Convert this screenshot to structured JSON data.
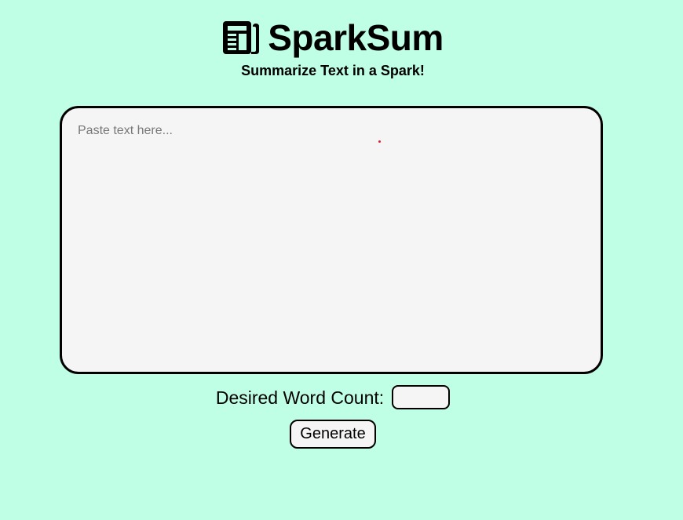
{
  "header": {
    "icon": "newspaper-icon",
    "title": "SparkSum",
    "tagline": "Summarize Text in a Spark!"
  },
  "editor": {
    "placeholder": "Paste text here...",
    "value": ""
  },
  "word_count": {
    "label": "Desired Word Count:",
    "value": ""
  },
  "actions": {
    "generate_label": "Generate"
  },
  "colors": {
    "background": "#bfffe6",
    "surface": "#f5f5f5",
    "border": "#000000"
  }
}
